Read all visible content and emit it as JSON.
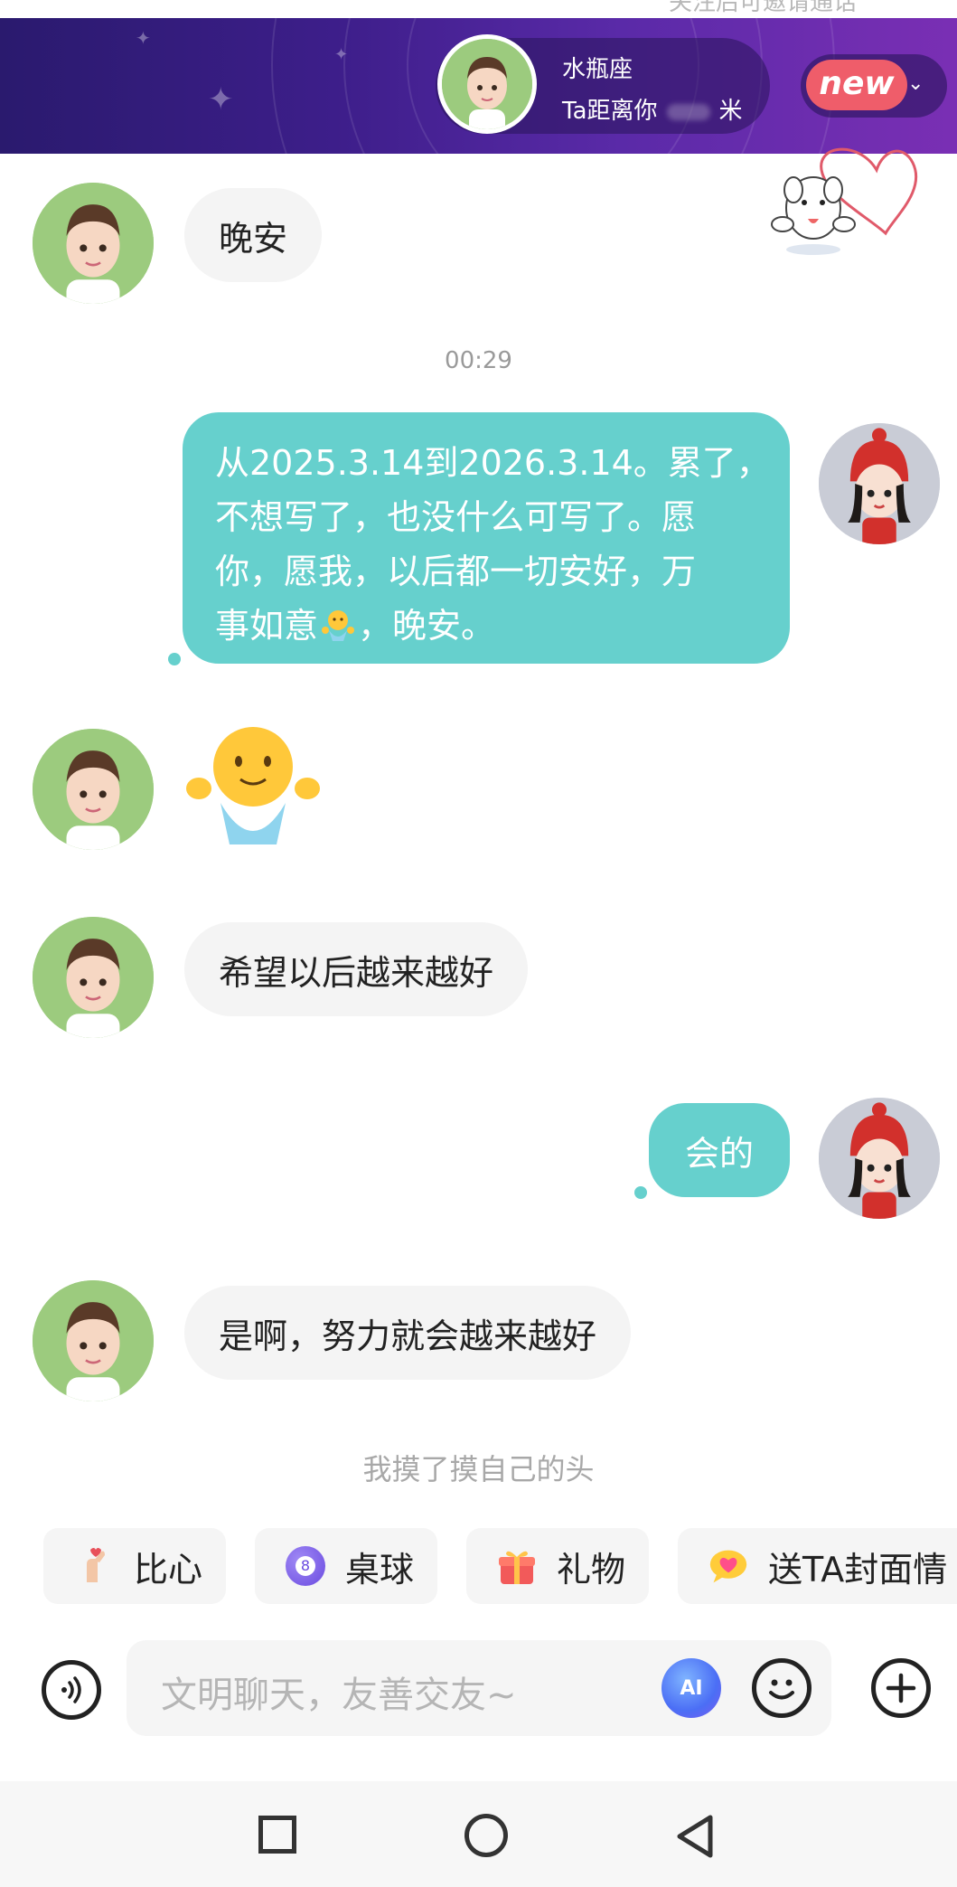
{
  "top_cut_text": "关注后可邀请通话",
  "banner": {
    "constellation": "水瓶座",
    "distance_prefix": "Ta距离你",
    "distance_unit": "米",
    "new_badge": "new",
    "chevron": "⌄"
  },
  "messages": [
    {
      "side": "left",
      "type": "text",
      "text": "晚安"
    },
    {
      "type": "time",
      "text": "00:29"
    },
    {
      "side": "right",
      "type": "text",
      "lines": [
        "从2025.3.14到2026.3.14。累了，",
        "不想写了，也没什么可写了。愿",
        "你，愿我，以后都一切安好，万",
        "事如意",
        "，晚安。"
      ]
    },
    {
      "side": "left",
      "type": "sticker",
      "sticker": "hug-emoji"
    },
    {
      "side": "left",
      "type": "text",
      "text": "希望以后越来越好"
    },
    {
      "side": "right",
      "type": "text",
      "text": "会的"
    },
    {
      "side": "left",
      "type": "text",
      "text": "是啊，努力就会越来越好"
    }
  ],
  "system_note": "我摸了摸自己的头",
  "quick_actions": [
    {
      "label": "比心",
      "icon": "finger-heart-icon"
    },
    {
      "label": "桌球",
      "icon": "billiard-ball-icon",
      "badge": "8"
    },
    {
      "label": "礼物",
      "icon": "gift-icon"
    },
    {
      "label": "送TA封面情",
      "icon": "heart-chat-icon"
    }
  ],
  "input": {
    "placeholder": "文明聊天，友善交友~",
    "ai_label": "AI"
  },
  "colors": {
    "bubble_right": "#66d0cd",
    "bubble_left": "#f4f4f4",
    "banner_start": "#2a1a6e",
    "banner_end": "#7a2fb4",
    "new_badge": "#ef5d6a"
  }
}
